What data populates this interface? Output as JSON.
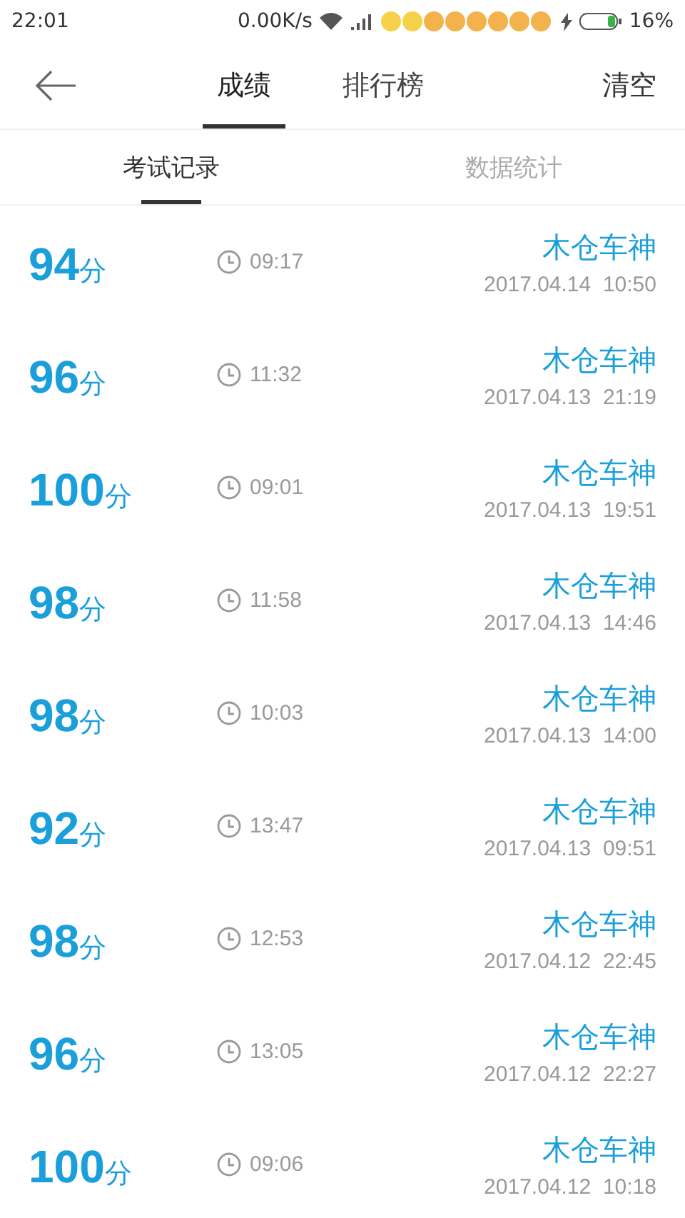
{
  "status_bar": {
    "time": "22:01",
    "speed": "0.00K/s",
    "battery": "16%"
  },
  "header": {
    "tabs": [
      {
        "label": "成绩",
        "selected": true
      },
      {
        "label": "排行榜",
        "selected": false
      }
    ],
    "action": "清空"
  },
  "sub_tabs": [
    {
      "label": "考试记录",
      "selected": true
    },
    {
      "label": "数据统计",
      "selected": false
    }
  ],
  "records": [
    {
      "score": "94",
      "unit": "分",
      "duration": "09:17",
      "name": "木仓车神",
      "date": "2017.04.14  10:50"
    },
    {
      "score": "96",
      "unit": "分",
      "duration": "11:32",
      "name": "木仓车神",
      "date": "2017.04.13  21:19"
    },
    {
      "score": "100",
      "unit": "分",
      "duration": "09:01",
      "name": "木仓车神",
      "date": "2017.04.13  19:51"
    },
    {
      "score": "98",
      "unit": "分",
      "duration": "11:58",
      "name": "木仓车神",
      "date": "2017.04.13  14:46"
    },
    {
      "score": "98",
      "unit": "分",
      "duration": "10:03",
      "name": "木仓车神",
      "date": "2017.04.13  14:00"
    },
    {
      "score": "92",
      "unit": "分",
      "duration": "13:47",
      "name": "木仓车神",
      "date": "2017.04.13  09:51"
    },
    {
      "score": "98",
      "unit": "分",
      "duration": "12:53",
      "name": "木仓车神",
      "date": "2017.04.12  22:45"
    },
    {
      "score": "96",
      "unit": "分",
      "duration": "13:05",
      "name": "木仓车神",
      "date": "2017.04.12  22:27"
    },
    {
      "score": "100",
      "unit": "分",
      "duration": "09:06",
      "name": "木仓车神",
      "date": "2017.04.12  10:18"
    }
  ]
}
